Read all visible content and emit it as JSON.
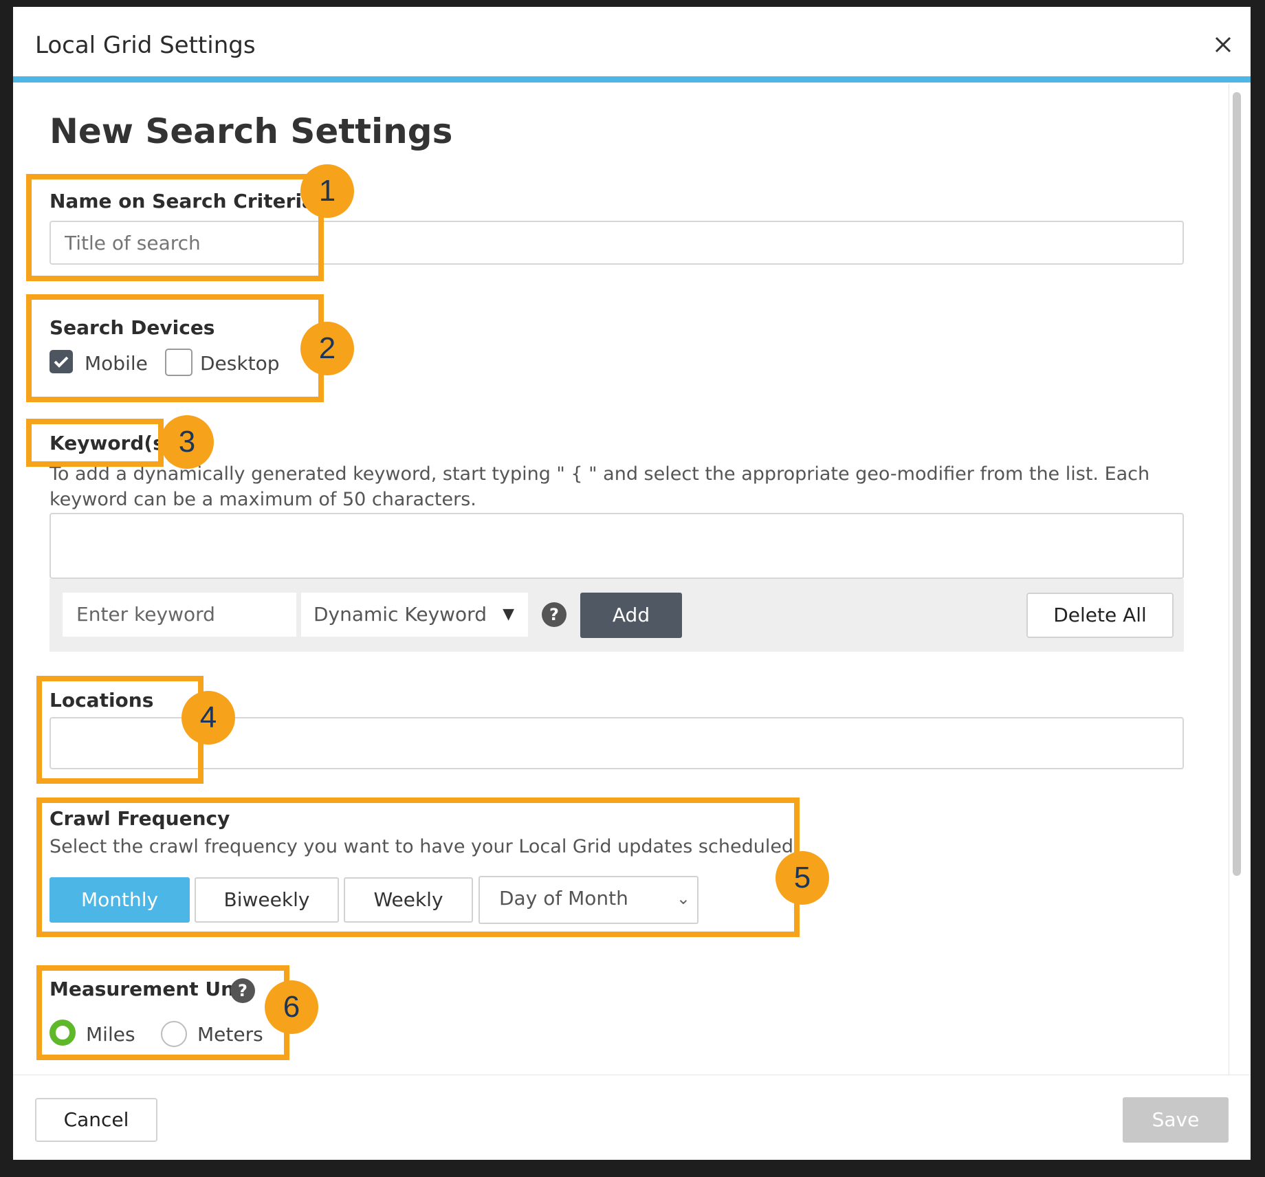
{
  "dialog": {
    "title": "Local Grid Settings",
    "close_icon": "close-icon",
    "accent_color": "#4cb7e6"
  },
  "form": {
    "heading": "New Search Settings",
    "name": {
      "label": "Name on Search Criteria",
      "placeholder": "Title of search"
    },
    "devices": {
      "label": "Search Devices",
      "options": [
        {
          "label": "Mobile",
          "checked": true
        },
        {
          "label": "Desktop",
          "checked": false
        }
      ]
    },
    "keywords": {
      "label": "Keyword(s)",
      "hint": "To add a dynamically generated keyword, start typing \" { \" and select the appropriate geo-modifier from the list. Each keyword can be a maximum of 50 characters.",
      "input_placeholder": "Enter keyword",
      "dynamic_select": "Dynamic Keyword",
      "add_label": "Add",
      "delete_all_label": "Delete All"
    },
    "locations": {
      "label": "Locations"
    },
    "crawl": {
      "label": "Crawl Frequency",
      "hint": "Select the crawl frequency you want to have your Local Grid updates scheduled.",
      "options": [
        "Monthly",
        "Biweekly",
        "Weekly"
      ],
      "selected": "Monthly",
      "day_select": "Day of Month"
    },
    "measurement": {
      "label": "Measurement Unit",
      "options": [
        {
          "label": "Miles",
          "selected": true
        },
        {
          "label": "Meters",
          "selected": false
        }
      ]
    }
  },
  "footer": {
    "cancel_label": "Cancel",
    "save_label": "Save"
  },
  "annotations": {
    "color": "#f7a21b",
    "badges": [
      "1",
      "2",
      "3",
      "4",
      "5",
      "6"
    ]
  }
}
